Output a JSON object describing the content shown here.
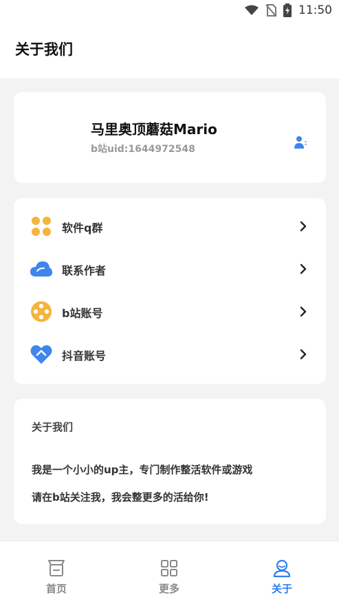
{
  "status_bar": {
    "time": "11:50",
    "icons": [
      "wifi-icon",
      "no-sim-icon",
      "battery-charging-icon"
    ]
  },
  "header": {
    "title": "关于我们"
  },
  "profile": {
    "name": "马里奥顶蘑菇Mario",
    "uid": "b站uid:1644972548",
    "action_icon": "user-card-icon"
  },
  "links": [
    {
      "label": "软件q群",
      "icon": "clover-icon",
      "color": "#f5b43c"
    },
    {
      "label": "联系作者",
      "icon": "cloud-icon",
      "color": "#3e86ec"
    },
    {
      "label": "b站账号",
      "icon": "film-reel-icon",
      "color": "#f5b43c"
    },
    {
      "label": "抖音账号",
      "icon": "heart-icon",
      "color": "#3e86ec"
    }
  ],
  "about": {
    "heading": "关于我们",
    "line1": "我是一个小小的up主，专门制作整活软件或游戏",
    "line2": "请在b站关注我，我会整更多的活给你!"
  },
  "nav": {
    "active": 2,
    "items": [
      {
        "label": "首页",
        "icon": "home-icon"
      },
      {
        "label": "更多",
        "icon": "grid-icon"
      },
      {
        "label": "关于",
        "icon": "person-icon"
      }
    ]
  },
  "colors": {
    "accent": "#2f7ef0",
    "orange": "#f5b43c",
    "blue": "#3e86ec",
    "background": "#f3f3f3"
  }
}
